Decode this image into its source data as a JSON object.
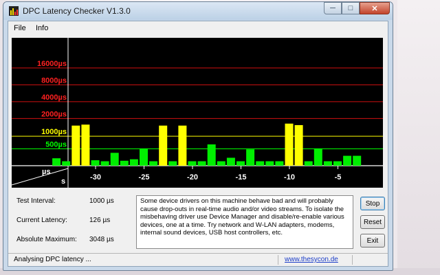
{
  "window": {
    "title": "DPC Latency Checker V1.3.0",
    "icon": "bar-chart-icon",
    "controls": {
      "minimize": "minimize-icon",
      "maximize": "maximize-icon",
      "close": "close-icon"
    }
  },
  "menu": [
    "File",
    "Info"
  ],
  "chart_data": {
    "type": "bar",
    "xlabel": "s",
    "ylabel": "µs",
    "y_ticks": [
      "16000µs",
      "8000µs",
      "4000µs",
      "2000µs",
      "1000µs",
      "500µs"
    ],
    "y_tick_colors": [
      "#ff2020",
      "#ff2020",
      "#ff2020",
      "#ff2020",
      "#ffff00",
      "#00ff00"
    ],
    "x_ticks": [
      "-30",
      "-25",
      "-20",
      "-15",
      "-10",
      "-5"
    ],
    "colors": {
      "green": "#00ee00",
      "yellow": "#ffff00",
      "red": "#d01010",
      "background": "#000000"
    },
    "bars": [
      {
        "t": -34.0,
        "level": 0.3,
        "c": "green"
      },
      {
        "t": -33.0,
        "level": 0.18,
        "c": "green"
      },
      {
        "t": -32.0,
        "level": 1.62,
        "c": "yellow"
      },
      {
        "t": -31.0,
        "level": 1.66,
        "c": "yellow"
      },
      {
        "t": -30.0,
        "level": 0.22,
        "c": "green"
      },
      {
        "t": -29.0,
        "level": 0.18,
        "c": "green"
      },
      {
        "t": -28.0,
        "level": 0.52,
        "c": "green"
      },
      {
        "t": -27.0,
        "level": 0.2,
        "c": "green"
      },
      {
        "t": -26.0,
        "level": 0.26,
        "c": "green"
      },
      {
        "t": -25.0,
        "level": 0.7,
        "c": "green"
      },
      {
        "t": -24.0,
        "level": 0.18,
        "c": "green"
      },
      {
        "t": -23.0,
        "level": 1.62,
        "c": "yellow"
      },
      {
        "t": -22.0,
        "level": 0.18,
        "c": "green"
      },
      {
        "t": -21.0,
        "level": 1.62,
        "c": "yellow"
      },
      {
        "t": -20.0,
        "level": 0.18,
        "c": "green"
      },
      {
        "t": -19.0,
        "level": 0.18,
        "c": "green"
      },
      {
        "t": -18.0,
        "level": 0.86,
        "c": "green"
      },
      {
        "t": -17.0,
        "level": 0.18,
        "c": "green"
      },
      {
        "t": -16.0,
        "level": 0.32,
        "c": "green"
      },
      {
        "t": -15.0,
        "level": 0.18,
        "c": "green"
      },
      {
        "t": -14.0,
        "level": 0.66,
        "c": "green"
      },
      {
        "t": -13.0,
        "level": 0.18,
        "c": "green"
      },
      {
        "t": -12.0,
        "level": 0.18,
        "c": "green"
      },
      {
        "t": -11.0,
        "level": 0.18,
        "c": "green"
      },
      {
        "t": -10.0,
        "level": 1.7,
        "c": "yellow"
      },
      {
        "t": -9.0,
        "level": 1.64,
        "c": "yellow"
      },
      {
        "t": -8.0,
        "level": 0.18,
        "c": "green"
      },
      {
        "t": -7.0,
        "level": 0.7,
        "c": "green"
      },
      {
        "t": -6.0,
        "level": 0.18,
        "c": "green"
      },
      {
        "t": -5.0,
        "level": 0.18,
        "c": "green"
      },
      {
        "t": -4.0,
        "level": 0.4,
        "c": "green"
      },
      {
        "t": -3.0,
        "level": 0.4,
        "c": "green"
      }
    ]
  },
  "info": {
    "test_interval_label": "Test Interval:",
    "test_interval_value": "1000 µs",
    "current_latency_label": "Current Latency:",
    "current_latency_value": "126 µs",
    "absolute_max_label": "Absolute Maximum:",
    "absolute_max_value": "3048 µs"
  },
  "message": "Some device drivers on this machine behave bad and will probably cause drop-outs in real-time audio and/or video streams. To isolate the misbehaving driver use Device Manager and disable/re-enable various devices, one at a time. Try network and W-LAN adapters, modems, internal sound devices, USB host controllers, etc.",
  "buttons": {
    "stop": "Stop",
    "reset": "Reset",
    "exit": "Exit"
  },
  "status": {
    "text": "Analysing DPC latency ...",
    "link": "www.thesycon.de"
  }
}
